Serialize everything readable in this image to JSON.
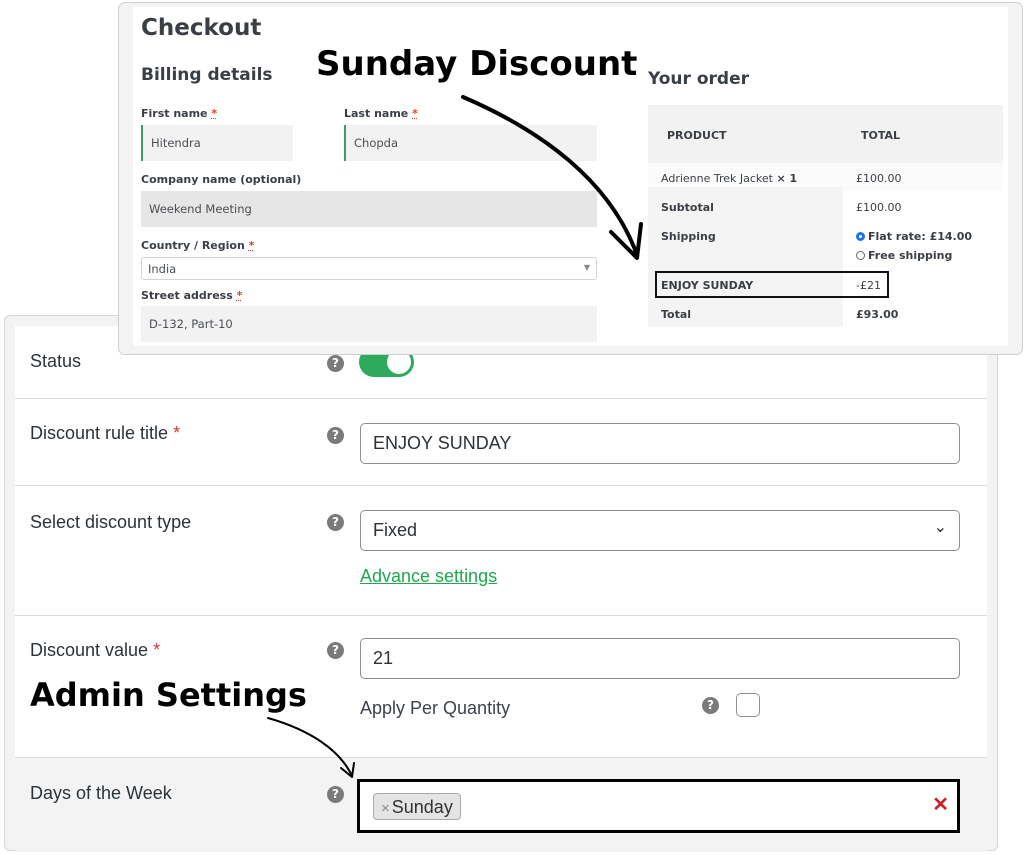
{
  "annotations": {
    "top": "Sunday Discount",
    "bottom": "Admin Settings"
  },
  "checkout": {
    "title": "Checkout",
    "billing_heading": "Billing details",
    "fields": {
      "first_name": {
        "label": "First name",
        "required_mark": "*",
        "value": "Hitendra"
      },
      "last_name": {
        "label": "Last name",
        "required_mark": "*",
        "value": "Chopda"
      },
      "company": {
        "label": "Company name (optional)",
        "value": "Weekend Meeting"
      },
      "country": {
        "label": "Country / Region",
        "required_mark": "*",
        "value": "India"
      },
      "street": {
        "label": "Street address",
        "required_mark": "*",
        "value": "D-132, Part-10"
      }
    },
    "order": {
      "heading": "Your order",
      "columns": [
        "PRODUCT",
        "TOTAL"
      ],
      "product": {
        "name": "Adrienne Trek Jacket",
        "qty": "× 1",
        "total": "£100.00"
      },
      "subtotal_label": "Subtotal",
      "subtotal_value": "£100.00",
      "shipping_label": "Shipping",
      "shipping_options": [
        {
          "label": "Flat rate: £14.00",
          "selected": true
        },
        {
          "label": "Free shipping",
          "selected": false
        }
      ],
      "discount_label": "ENJOY SUNDAY",
      "discount_value": "-£21",
      "total_label": "Total",
      "total_value": "£93.00"
    }
  },
  "admin": {
    "help_glyph": "?",
    "status": {
      "label": "Status",
      "enabled": true
    },
    "title": {
      "label": "Discount rule title",
      "required_mark": "*",
      "value": "ENJOY SUNDAY"
    },
    "discount_type": {
      "label": "Select discount type",
      "value": "Fixed",
      "advance_link": "Advance settings"
    },
    "discount_value": {
      "label": "Discount value",
      "required_mark": "*",
      "value": "21",
      "apply_per_quantity_label": "Apply Per Quantity",
      "apply_per_quantity_checked": false
    },
    "days": {
      "label": "Days of the Week",
      "selected": [
        "Sunday"
      ],
      "chip_remove": "×",
      "clear": "✕"
    }
  },
  "colors": {
    "accent_green": "#2eaa5c",
    "link_green": "#1fa84f",
    "required_red": "#d63638",
    "clear_red": "#d0202a",
    "radio_blue": "#1e73e8"
  }
}
